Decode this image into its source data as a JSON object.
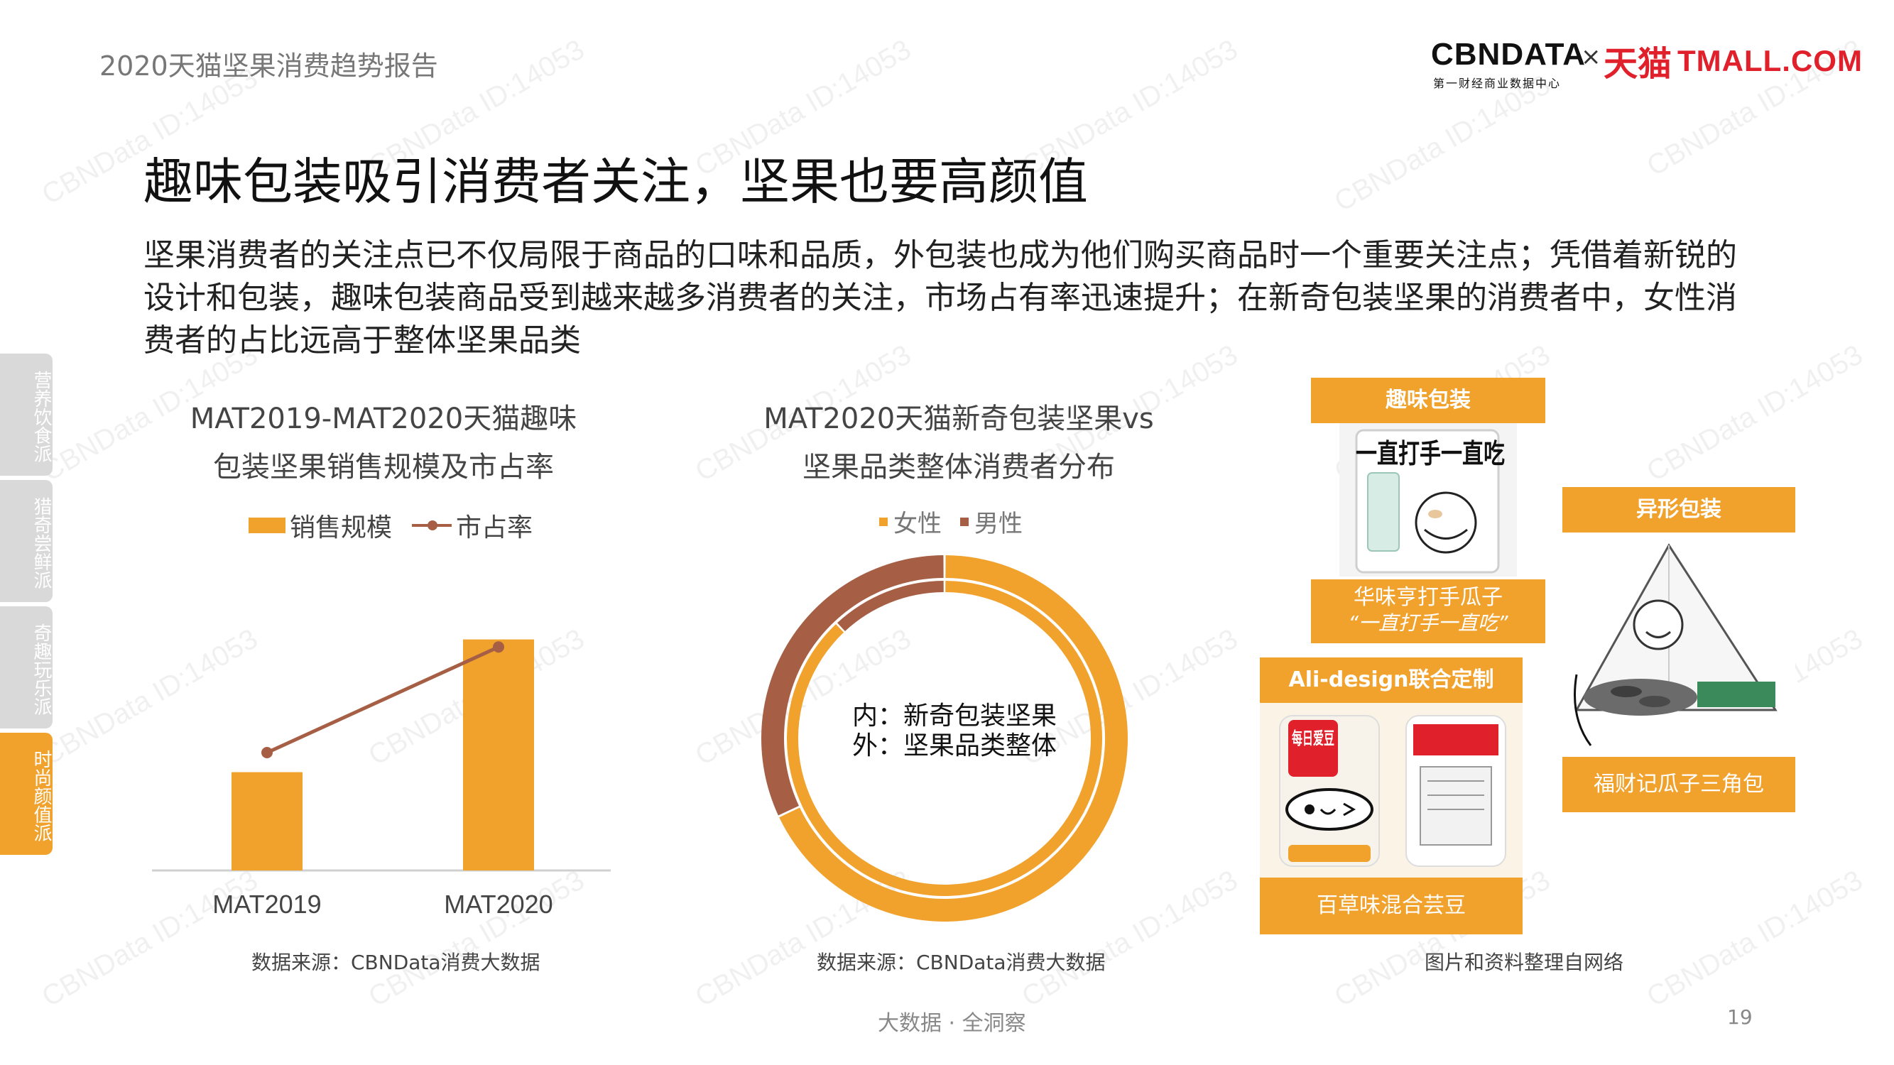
{
  "header": {
    "report_title": "2020天猫坚果消费趋势报告",
    "logo_cbn": "CBNDATA",
    "logo_cbn_sub": "第一财经商业数据中心",
    "logo_times": "×",
    "logo_tmall_cn": "天猫",
    "logo_tmall_en": "TMALL.COM"
  },
  "watermark": "CBNData ID:14053",
  "title": "趣味包装吸引消费者关注，坚果也要高颜值",
  "intro": "坚果消费者的关注点已不仅局限于商品的口味和品质，外包装也成为他们购买商品时一个重要关注点；凭借着新锐的设计和包装，趣味包装商品受到越来越多消费者的关注，市场占有率迅速提升；在新奇包装坚果的消费者中，女性消费者的占比远高于整体坚果品类",
  "side_tabs": [
    {
      "label": "营养饮食派",
      "active": false
    },
    {
      "label": "猎奇尝鲜派",
      "active": false
    },
    {
      "label": "奇趣玩乐派",
      "active": false
    },
    {
      "label": "时尚颜值派",
      "active": true
    }
  ],
  "chart1": {
    "title_line1": "MAT2019-MAT2020天猫趣味",
    "title_line2": "包装坚果销售规模及市占率",
    "source": "数据来源：CBNData消费大数据"
  },
  "chart2": {
    "title_line1": "MAT2020天猫新奇包装坚果vs",
    "title_line2": "坚果品类整体消费者分布",
    "center_line1": "内：新奇包装坚果",
    "center_line2": "外：坚果品类整体",
    "source": "数据来源：CBNData消费大数据"
  },
  "chart_data": [
    {
      "type": "bar",
      "categories": [
        "MAT2019",
        "MAT2020"
      ],
      "series": [
        {
          "name": "销售规模",
          "kind": "bar",
          "values": [
            1.0,
            2.35
          ]
        },
        {
          "name": "市占率",
          "kind": "line",
          "values": [
            1.0,
            2.4
          ]
        }
      ],
      "legend_position": "top",
      "grid": false
    },
    {
      "type": "pie",
      "subtype": "double-donut",
      "labels": [
        "女性",
        "男性"
      ],
      "rings": [
        {
          "name": "内：新奇包装坚果",
          "values": [
            88,
            12
          ]
        },
        {
          "name": "外：坚果品类整体",
          "values": [
            68,
            32
          ]
        }
      ],
      "legend_position": "top"
    }
  ],
  "products": {
    "fun_pack": {
      "header": "趣味包装",
      "caption_line1": "华味亨打手瓜子",
      "caption_line2": "“一直打手一直吃”",
      "pack_text": "一直打手一直吃"
    },
    "shaped_pack": {
      "header": "异形包装",
      "caption": "福财记瓜子三角包"
    },
    "ali_design": {
      "header": "Ali-design联合定制",
      "caption": "百草味混合芸豆",
      "pack_text": "每日爱豆"
    },
    "source": "图片和资料整理自网络"
  },
  "footer": {
    "slogan": "大数据 · 全洞察",
    "page": "19"
  },
  "colors": {
    "accent": "#f0a22d",
    "secondary": "#a65f45",
    "tab_inactive": "#d9d9d9",
    "tmall_red": "#e0202a"
  }
}
